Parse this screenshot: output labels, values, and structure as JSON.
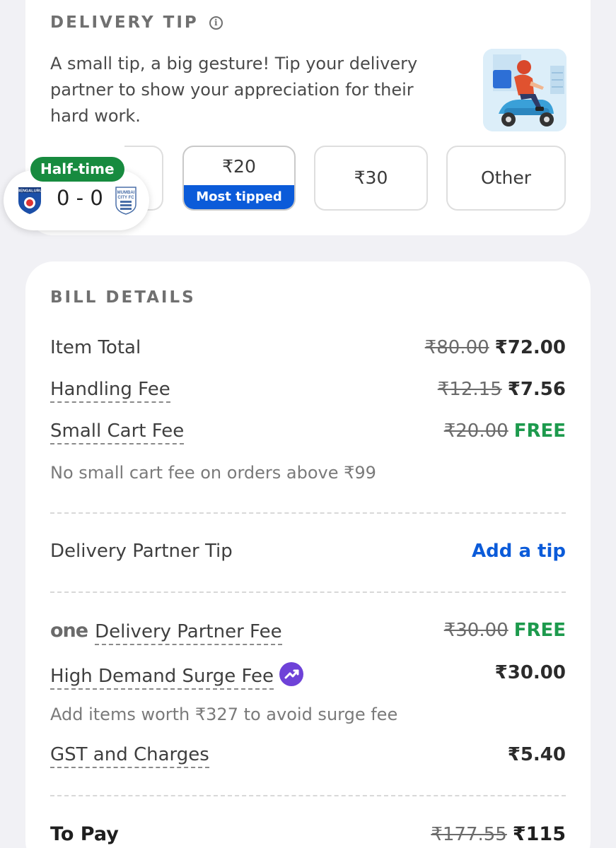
{
  "tip_section": {
    "title": "DELIVERY TIP",
    "info_icon": "info-icon",
    "description": "A small tip, a big gesture! Tip your delivery partner to show your appreciation for their hard work.",
    "options": [
      {
        "amount": "₹20",
        "badge": "Most tipped"
      },
      {
        "amount": "₹30"
      },
      {
        "amount": "Other"
      }
    ]
  },
  "score_widget": {
    "status": "Half-time",
    "score": "0 - 0",
    "home_team_logo": "BENGALURU",
    "away_team_logo": "MUMBAI CITY FC"
  },
  "bill": {
    "title": "BILL DETAILS",
    "item_total": {
      "label": "Item Total",
      "original": "₹80.00",
      "final": "₹72.00"
    },
    "handling_fee": {
      "label": "Handling Fee",
      "original": "₹12.15",
      "final": "₹7.56"
    },
    "small_cart_fee": {
      "label": "Small Cart Fee",
      "original": "₹20.00",
      "final": "FREE"
    },
    "small_cart_note": "No small cart fee on orders above ₹99",
    "tip": {
      "label": "Delivery Partner Tip",
      "action": "Add a tip"
    },
    "delivery_fee": {
      "brand": "one",
      "label": "Delivery Partner Fee",
      "original": "₹30.00",
      "final": "FREE"
    },
    "surge_fee": {
      "label": "High Demand Surge Fee",
      "icon": "trending-up-icon",
      "final": "₹30.00"
    },
    "surge_note": "Add items worth ₹327 to avoid surge fee",
    "gst": {
      "label": "GST and Charges",
      "final": "₹5.40"
    },
    "to_pay": {
      "label": "To Pay",
      "original": "₹177.55",
      "final": "₹115"
    }
  },
  "colors": {
    "accent_blue": "#0b5bd9",
    "free_green": "#1d9a4d",
    "score_badge_green": "#178b3f",
    "surge_purple": "#6e42d8"
  }
}
